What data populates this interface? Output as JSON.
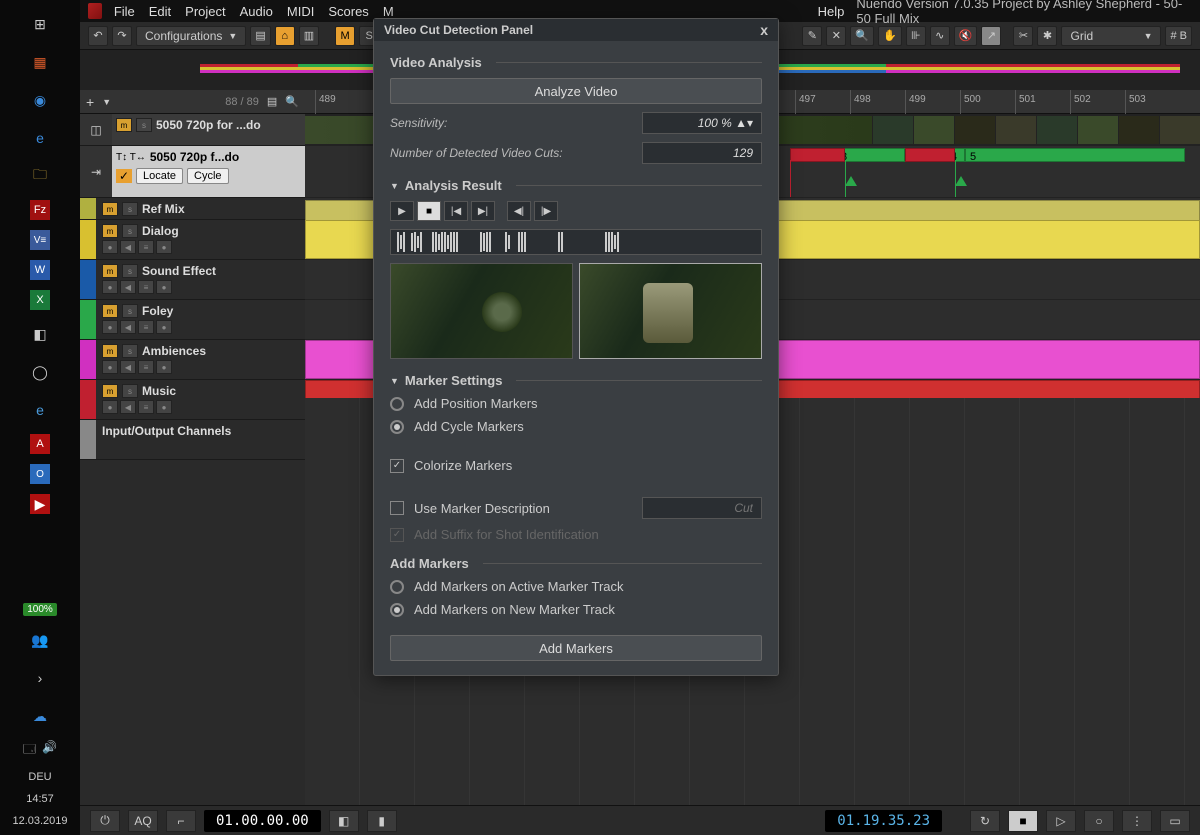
{
  "taskbar": {
    "zoom": "100%",
    "lang": "DEU",
    "time": "14:57",
    "date": "12.03.2019"
  },
  "titlebar": {
    "menus": [
      "File",
      "Edit",
      "Project",
      "Audio",
      "MIDI",
      "Scores",
      "M",
      "Help"
    ],
    "project_title": "Nuendo Version 7.0.35 Project by Ashley Shepherd - 50-50 Full Mix"
  },
  "toolbar": {
    "configurations": "Configurations",
    "m_label": "M",
    "s_label": "S",
    "snap_label": "Grid",
    "beats_label": "# B"
  },
  "trackpanel": {
    "counter": "88 / 89",
    "marker1": "5050 720p for ...do",
    "marker2": "5050 720p f...do",
    "locate": "Locate",
    "cycle": "Cycle",
    "tracks": [
      "Ref Mix",
      "Dialog",
      "Sound Effect",
      "Foley",
      "Ambiences",
      "Music",
      "Input/Output Channels"
    ],
    "track_colors": [
      "#b0b040",
      "#d8c030",
      "#1a5aa8",
      "#2aa84a",
      "#d030c0",
      "#c02030",
      "#888"
    ]
  },
  "ruler": {
    "numbers": [
      "489",
      "497",
      "498",
      "499",
      "500",
      "501",
      "502",
      "503"
    ],
    "cycle_markers": [
      "3",
      "4",
      "5"
    ]
  },
  "dialog": {
    "title": "Video Cut Detection Panel",
    "video_analysis_hdr": "Video Analysis",
    "analyze_btn": "Analyze Video",
    "sensitivity_lbl": "Sensitivity:",
    "sensitivity_val": "100 %",
    "cuts_lbl": "Number of Detected Video Cuts:",
    "cuts_val": "129",
    "analysis_result_hdr": "Analysis Result",
    "marker_settings_hdr": "Marker Settings",
    "add_position": "Add Position Markers",
    "add_cycle": "Add Cycle Markers",
    "colorize": "Colorize Markers",
    "use_desc": "Use Marker Description",
    "desc_placeholder": "Cut",
    "add_suffix": "Add Suffix for Shot Identification",
    "add_markers_hdr": "Add Markers",
    "add_active": "Add Markers on Active Marker Track",
    "add_new": "Add Markers on New Marker Track",
    "add_markers_btn": "Add Markers"
  },
  "transport": {
    "aq": "AQ",
    "tc1": "01.00.00.00",
    "tc2": "01.19.35.23"
  }
}
